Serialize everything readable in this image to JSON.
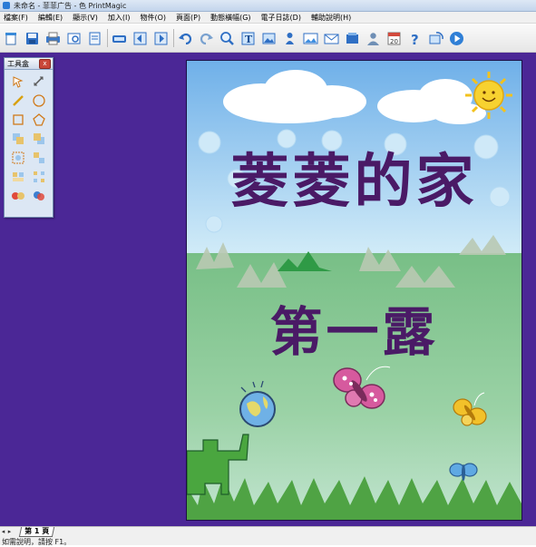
{
  "window": {
    "title": "未命名 - 菲菲广告 - 色 PrintMagic"
  },
  "menu": {
    "items": [
      "檔案(F)",
      "編輯(E)",
      "顯示(V)",
      "加入(I)",
      "物件(O)",
      "頁面(P)",
      "動態橫幅(G)",
      "電子日誌(D)",
      "輔助說明(H)"
    ]
  },
  "toolbar": {
    "buttons": [
      "new-icon",
      "save-icon",
      "print-icon",
      "print-preview-icon",
      "print-setup-icon",
      "scan-icon",
      "page-prev-icon",
      "page-next-icon",
      "undo-icon",
      "redo-icon",
      "zoom-icon",
      "insert-text-icon",
      "insert-picture-icon",
      "clipart-icon",
      "photo-icon",
      "email-icon",
      "album-icon",
      "contact-icon",
      "calendar-icon",
      "help-icon",
      "web-icon",
      "play-icon"
    ],
    "calendar_text": "20"
  },
  "toolbox": {
    "title": "工具盒",
    "close_label": "x",
    "tools": [
      "pointer",
      "rotate",
      "line",
      "ellipse",
      "rectangle",
      "polygon",
      "bring-forward",
      "send-backward",
      "group",
      "ungroup",
      "align",
      "distribute",
      "fill-color",
      "shadow"
    ]
  },
  "cover": {
    "title_line1": "菱菱的家",
    "title_line2": "第一露"
  },
  "colors": {
    "workspace": "#4b2796",
    "title": "#4a1a66",
    "sky": "#9ac9ef",
    "grass": "#8cc78f"
  },
  "status": {
    "page_tab": "第 1 頁",
    "hint": "如需說明，請按 F1。"
  }
}
